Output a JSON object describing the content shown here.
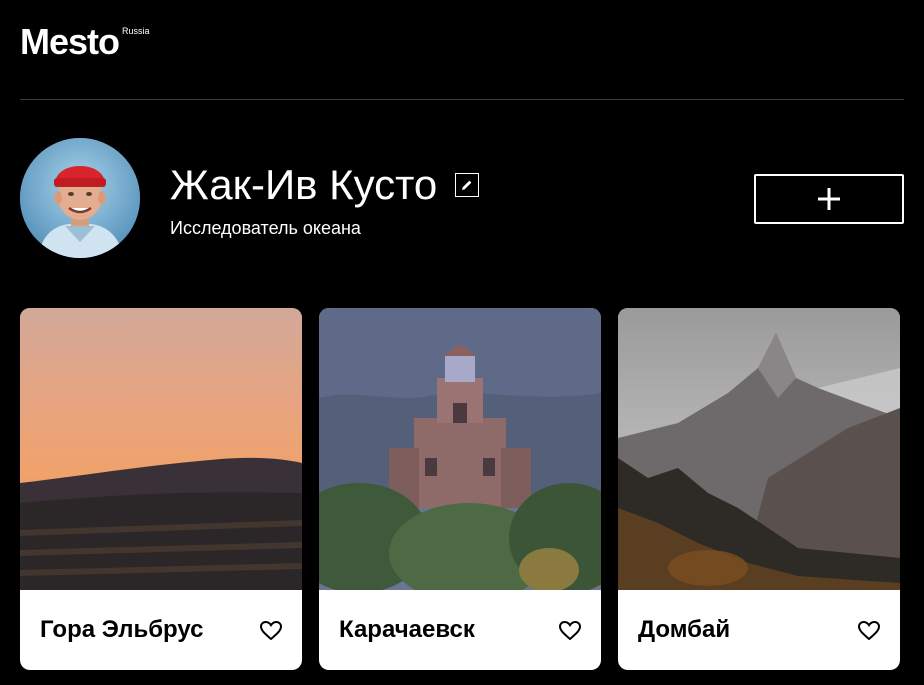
{
  "header": {
    "logo_text": "Mesto",
    "logo_sup": "Russia"
  },
  "profile": {
    "name": "Жак-Ив Кусто",
    "about": "Исследователь океана",
    "edit_icon": "pencil-icon",
    "add_icon": "plus-icon"
  },
  "cards": [
    {
      "title": "Гора Эльбрус",
      "image_icon": "mountain-sunset-image",
      "like_icon": "heart-outline-icon"
    },
    {
      "title": "Карачаевск",
      "image_icon": "church-image",
      "like_icon": "heart-outline-icon"
    },
    {
      "title": "Домбай",
      "image_icon": "mountain-peak-image",
      "like_icon": "heart-outline-icon"
    }
  ],
  "colors": {
    "background": "#000000",
    "text": "#ffffff",
    "card_background": "#ffffff",
    "card_text": "#000000",
    "divider": "#545454"
  }
}
